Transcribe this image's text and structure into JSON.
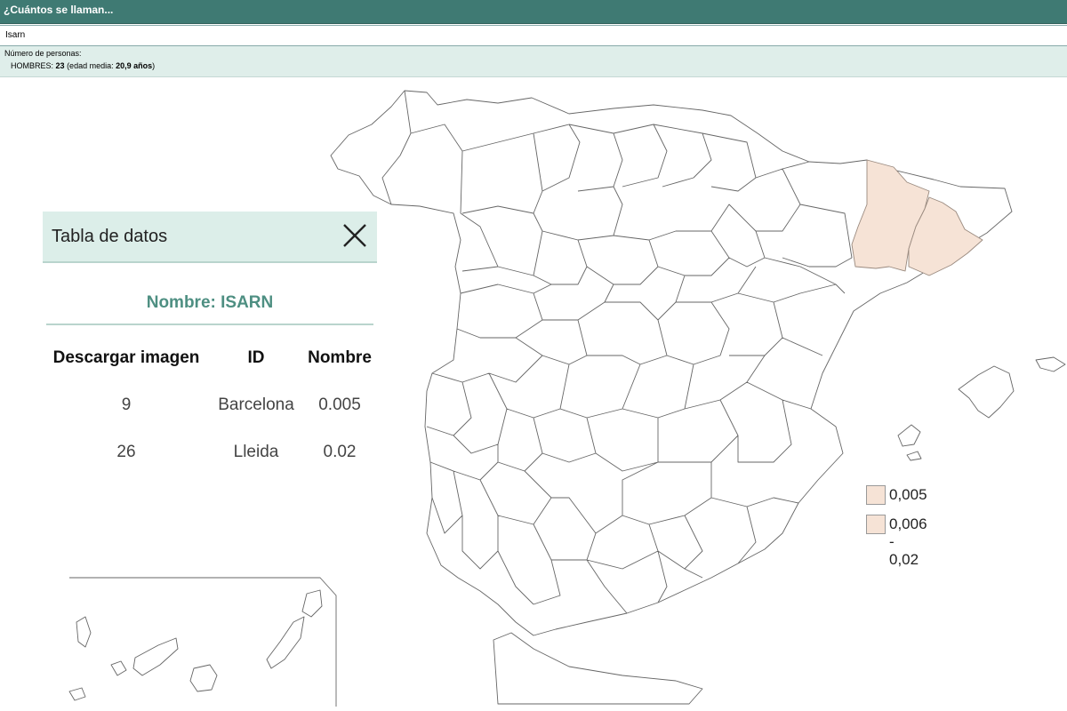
{
  "header": {
    "title": "¿Cuántos se llaman..."
  },
  "search": {
    "value": "Isarn"
  },
  "info": {
    "label": "Número de personas:",
    "sex": "HOMBRES:",
    "count": "23",
    "age_prefix": "(edad media:",
    "age": "20,9 años",
    "age_suffix": ")"
  },
  "panel": {
    "title": "Tabla de datos",
    "name_line": "Nombre: ISARN",
    "columns": [
      "Descargar imagen",
      "ID",
      "Nombre"
    ],
    "rows": [
      [
        "9",
        "Barcelona",
        "0.005"
      ],
      [
        "26",
        "Lleida",
        "0.02"
      ]
    ]
  },
  "legend": {
    "items": [
      {
        "label": "0,005",
        "color": "#f6e3d6"
      },
      {
        "label": "0,006 - 0,02",
        "color": "#f6e3d6"
      }
    ]
  },
  "colors": {
    "header_bg": "#3f7a73",
    "highlight_fill": "#f6e3d6",
    "panel_bg": "#dceee9",
    "accent_text": "#4e8f82"
  }
}
